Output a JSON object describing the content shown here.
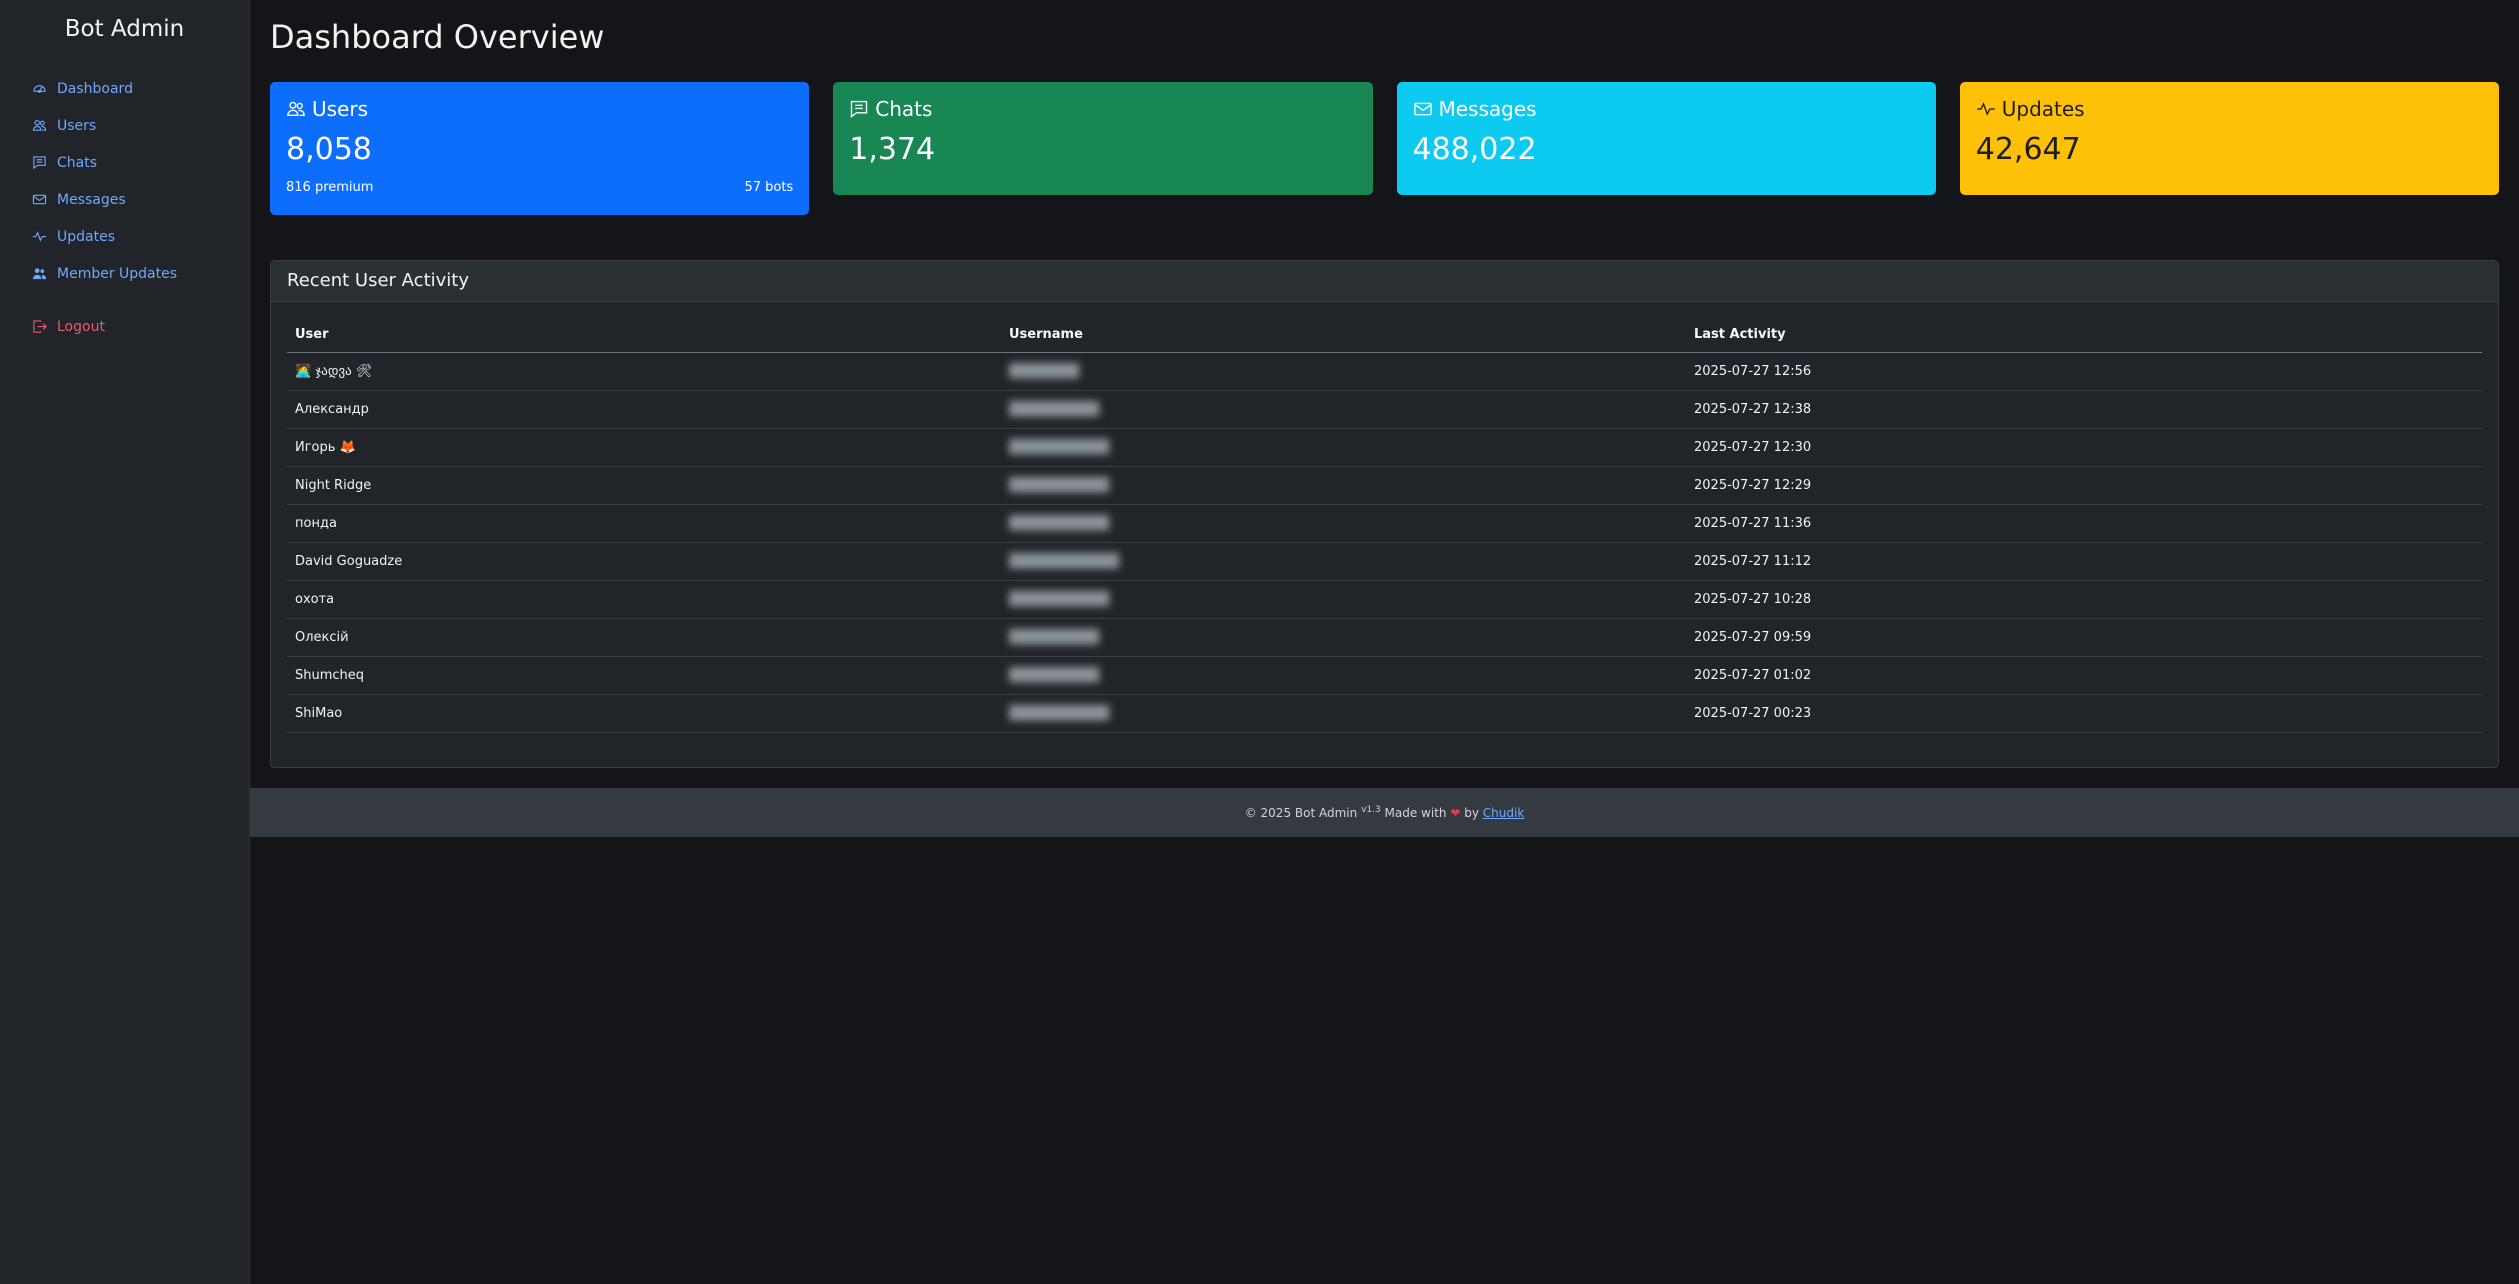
{
  "sidebar": {
    "brand": "Bot Admin",
    "items": [
      {
        "label": "Dashboard",
        "icon": "speedometer-icon"
      },
      {
        "label": "Users",
        "icon": "people-icon"
      },
      {
        "label": "Chats",
        "icon": "chat-icon"
      },
      {
        "label": "Messages",
        "icon": "envelope-icon"
      },
      {
        "label": "Updates",
        "icon": "activity-icon"
      },
      {
        "label": "Member Updates",
        "icon": "people-fill-icon"
      }
    ],
    "logout": {
      "label": "Logout",
      "icon": "logout-icon"
    }
  },
  "page": {
    "title": "Dashboard Overview"
  },
  "stats": {
    "users": {
      "label": "Users",
      "value": "8,058",
      "premium": "816 premium",
      "bots": "57 bots",
      "color": "#0d6efd"
    },
    "chats": {
      "label": "Chats",
      "value": "1,374",
      "color": "#198754"
    },
    "messages": {
      "label": "Messages",
      "value": "488,022",
      "color": "#0dcaf0"
    },
    "updates": {
      "label": "Updates",
      "value": "42,647",
      "color": "#ffc107"
    }
  },
  "activity": {
    "title": "Recent User Activity",
    "columns": [
      "User",
      "Username",
      "Last Activity"
    ],
    "rows": [
      {
        "user": "🧑‍💻 ჯადვა 🛠",
        "username": "███████",
        "last": "2025-07-27 12:56"
      },
      {
        "user": "Александр",
        "username": "█████████",
        "last": "2025-07-27 12:38"
      },
      {
        "user": "Игорь 🦊",
        "username": "██████████",
        "last": "2025-07-27 12:30"
      },
      {
        "user": "Night Ridge",
        "username": "██████████",
        "last": "2025-07-27 12:29"
      },
      {
        "user": "понда",
        "username": "██████████",
        "last": "2025-07-27 11:36"
      },
      {
        "user": "David Goguadze",
        "username": "███████████",
        "last": "2025-07-27 11:12"
      },
      {
        "user": "охота",
        "username": "██████████",
        "last": "2025-07-27 10:28"
      },
      {
        "user": "Олексій",
        "username": "█████████",
        "last": "2025-07-27 09:59"
      },
      {
        "user": "Shumcheq",
        "username": "█████████",
        "last": "2025-07-27 01:02"
      },
      {
        "user": "ShiMao",
        "username": "██████████",
        "last": "2025-07-27 00:23"
      }
    ]
  },
  "footer": {
    "copyright": "© 2025 Bot Admin",
    "version": "v1.3",
    "made_with": "Made with",
    "heart": "❤",
    "by": "by",
    "author": "Chudik"
  }
}
